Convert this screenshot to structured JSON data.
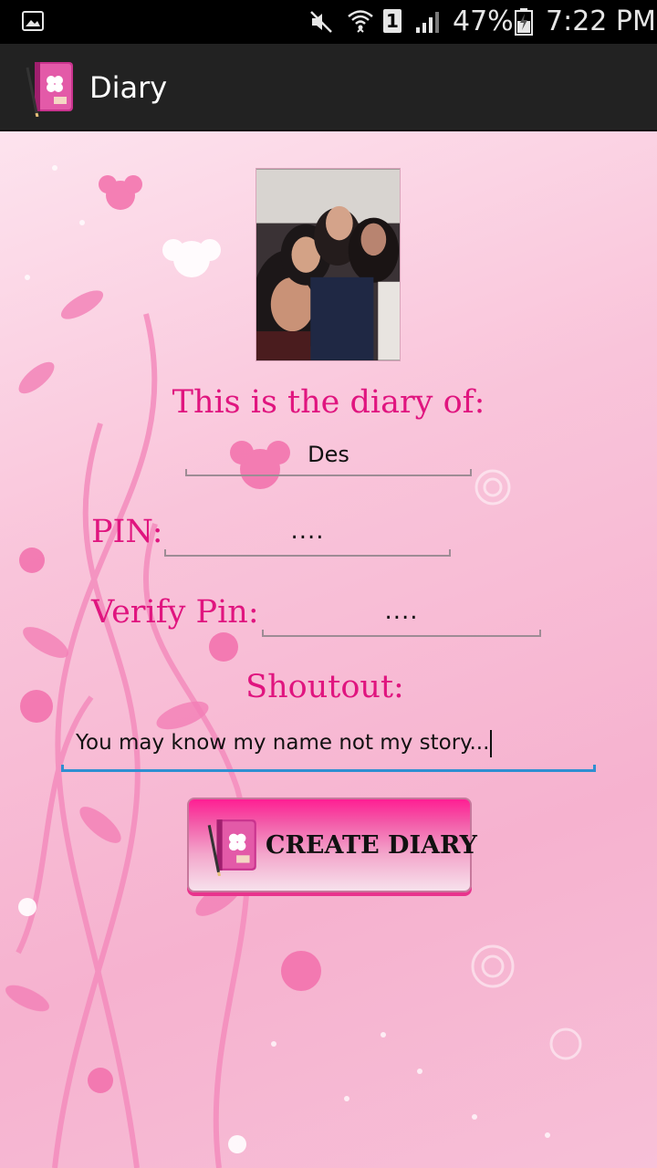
{
  "status_bar": {
    "battery_percent": "47%",
    "time": "7:22 PM",
    "sim_slot": "1",
    "icons": [
      "gallery-icon",
      "mute-icon",
      "wifi-icon",
      "sim-icon",
      "signal-icon",
      "battery-icon"
    ]
  },
  "action_bar": {
    "title": "Diary",
    "icon": "diary-book-icon"
  },
  "form": {
    "diary_of_label": "This is the diary of:",
    "name_value": "Des",
    "pin_label": "PIN:",
    "pin_value": "....",
    "verify_label": "Verify Pin:",
    "verify_value": "....",
    "shoutout_label": "Shoutout:",
    "shoutout_value": "You may know my name not my story..."
  },
  "create_button": {
    "label": "CREATE DIARY",
    "icon": "diary-book-icon"
  },
  "colors": {
    "accent_text": "#e0157f",
    "focused_underline": "#2f8fd1",
    "action_bar": "#222222",
    "background_pink": "#f6b2cf"
  }
}
